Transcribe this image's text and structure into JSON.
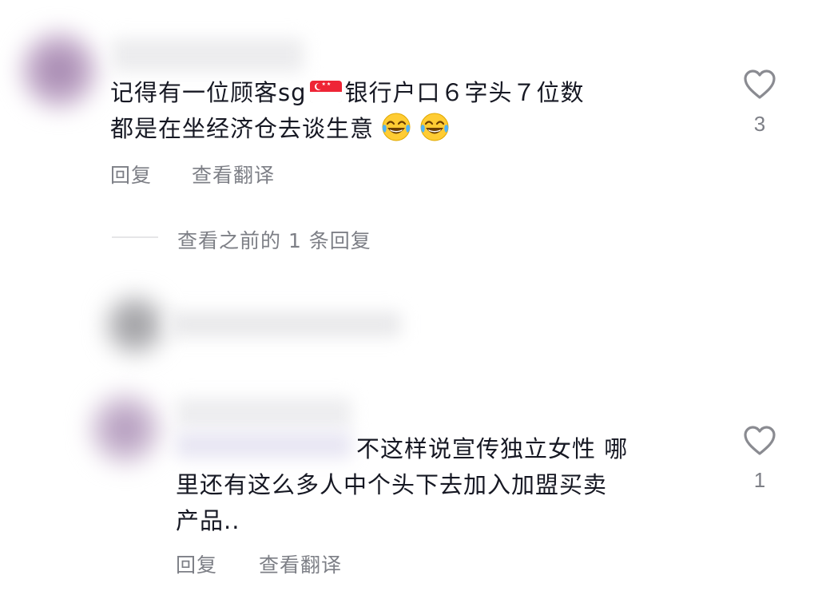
{
  "comments": [
    {
      "text_line1_a": "记得有一位顾客sg",
      "flag_icon": "singapore-flag-icon",
      "text_line1_b": "银行户口６字头７位数",
      "text_line2": "都是在坐经济仓去谈生意",
      "emoji_icon": "tears-of-joy-emoji",
      "reply_label": "回复",
      "translate_label": "查看翻译",
      "likes": "3"
    },
    {
      "text_line1": "不这样说宣传独立女性 哪",
      "text_line2": "里还有这么多人中个头下去加入加盟买卖",
      "text_line3": "产品..",
      "reply_label": "回复",
      "translate_label": "查看翻译",
      "likes": "1"
    }
  ],
  "thread": {
    "view_previous_label": "查看之前的 1 条回复"
  },
  "colors": {
    "text": "#161823",
    "secondary": "#7d7f86",
    "heart_outline": "#8a8b91"
  }
}
